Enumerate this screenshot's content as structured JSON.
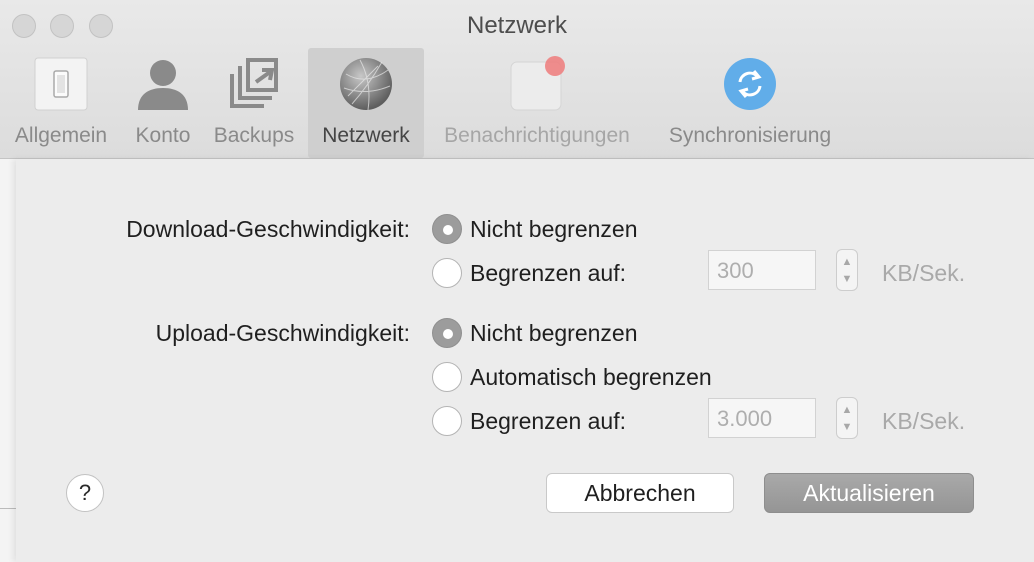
{
  "window": {
    "title": "Netzwerk"
  },
  "toolbar": {
    "tabs": [
      {
        "label": "Allgemein",
        "icon": "switch-icon"
      },
      {
        "label": "Konto",
        "icon": "person-icon"
      },
      {
        "label": "Backups",
        "icon": "backup-icon"
      },
      {
        "label": "Netzwerk",
        "icon": "globe-icon",
        "selected": true
      },
      {
        "label": "Benachrichtigungen",
        "icon": "notification-icon"
      },
      {
        "label": "Synchronisierung",
        "icon": "sync-icon"
      }
    ]
  },
  "download": {
    "label": "Download-Geschwindigkeit:",
    "options": [
      "Nicht begrenzen",
      "Begrenzen auf:"
    ],
    "selected_option": "Nicht begrenzen",
    "limit_value": "300",
    "unit": "KB/Sek."
  },
  "upload": {
    "label": "Upload-Geschwindigkeit:",
    "options": [
      "Nicht begrenzen",
      "Automatisch begrenzen",
      "Begrenzen auf:"
    ],
    "selected_option": "Nicht begrenzen",
    "limit_value": "3.000",
    "unit": "KB/Sek."
  },
  "buttons": {
    "help": "?",
    "cancel": "Abbrechen",
    "update": "Aktualisieren"
  },
  "colors": {
    "sync_blue": "#4aa3ea",
    "badge_red": "#ef7b7b"
  }
}
